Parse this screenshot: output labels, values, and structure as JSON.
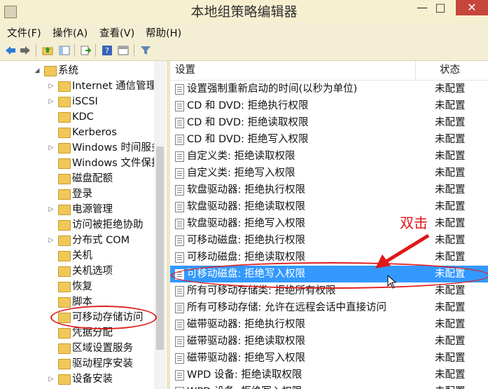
{
  "window": {
    "title": "本地组策略编辑器",
    "min": "—",
    "max": "□",
    "close": "✕"
  },
  "menu": [
    "文件(F)",
    "操作(A)",
    "查看(V)",
    "帮助(H)"
  ],
  "toolbar": {
    "icons": [
      "back-arrow-icon",
      "forward-arrow-icon",
      "up-folder-icon",
      "show-hide-tree-icon",
      "export-list-icon",
      "help-icon",
      "extended-view-icon",
      "filter-icon"
    ]
  },
  "tree": {
    "items": [
      {
        "label": "系统",
        "arrow": "◢",
        "indent": 0
      },
      {
        "label": "Internet 通信管理",
        "arrow": "▷",
        "indent": 1
      },
      {
        "label": "iSCSI",
        "arrow": "▷",
        "indent": 1
      },
      {
        "label": "KDC",
        "arrow": "",
        "indent": 1
      },
      {
        "label": "Kerberos",
        "arrow": "",
        "indent": 1
      },
      {
        "label": "Windows 时间服务",
        "arrow": "▷",
        "indent": 1
      },
      {
        "label": "Windows 文件保护",
        "arrow": "",
        "indent": 1
      },
      {
        "label": "磁盘配额",
        "arrow": "",
        "indent": 1
      },
      {
        "label": "登录",
        "arrow": "",
        "indent": 1
      },
      {
        "label": "电源管理",
        "arrow": "▷",
        "indent": 1
      },
      {
        "label": "访问被拒绝协助",
        "arrow": "",
        "indent": 1
      },
      {
        "label": "分布式 COM",
        "arrow": "▷",
        "indent": 1
      },
      {
        "label": "关机",
        "arrow": "",
        "indent": 1
      },
      {
        "label": "关机选项",
        "arrow": "",
        "indent": 1
      },
      {
        "label": "恢复",
        "arrow": "",
        "indent": 1
      },
      {
        "label": "脚本",
        "arrow": "",
        "indent": 1
      },
      {
        "label": "可移动存储访问",
        "arrow": "",
        "indent": 1
      },
      {
        "label": "凭据分配",
        "arrow": "",
        "indent": 1
      },
      {
        "label": "区域设置服务",
        "arrow": "",
        "indent": 1
      },
      {
        "label": "驱动程序安装",
        "arrow": "",
        "indent": 1
      },
      {
        "label": "设备安装",
        "arrow": "▷",
        "indent": 1
      }
    ]
  },
  "list": {
    "columns": {
      "setting": "设置",
      "state": "状态"
    },
    "rows": [
      {
        "name": "设置强制重新启动的时间(以秒为单位)",
        "state": "未配置"
      },
      {
        "name": "CD 和 DVD: 拒绝执行权限",
        "state": "未配置"
      },
      {
        "name": "CD 和 DVD: 拒绝读取权限",
        "state": "未配置"
      },
      {
        "name": "CD 和 DVD: 拒绝写入权限",
        "state": "未配置"
      },
      {
        "name": "自定义类: 拒绝读取权限",
        "state": "未配置"
      },
      {
        "name": "自定义类: 拒绝写入权限",
        "state": "未配置"
      },
      {
        "name": "软盘驱动器: 拒绝执行权限",
        "state": "未配置"
      },
      {
        "name": "软盘驱动器: 拒绝读取权限",
        "state": "未配置"
      },
      {
        "name": "软盘驱动器: 拒绝写入权限",
        "state": "未配置"
      },
      {
        "name": "可移动磁盘: 拒绝执行权限",
        "state": "未配置"
      },
      {
        "name": "可移动磁盘: 拒绝读取权限",
        "state": "未配置"
      },
      {
        "name": "可移动磁盘: 拒绝写入权限",
        "state": "未配置"
      },
      {
        "name": "所有可移动存储类: 拒绝所有权限",
        "state": "未配置"
      },
      {
        "name": "所有可移动存储: 允许在远程会话中直接访问",
        "state": "未配置"
      },
      {
        "name": "磁带驱动器: 拒绝执行权限",
        "state": "未配置"
      },
      {
        "name": "磁带驱动器: 拒绝读取权限",
        "state": "未配置"
      },
      {
        "name": "磁带驱动器: 拒绝写入权限",
        "state": "未配置"
      },
      {
        "name": "WPD 设备: 拒绝读取权限",
        "state": "未配置"
      },
      {
        "name": "WPD 设备: 拒绝写入权限",
        "state": "未配置"
      }
    ]
  },
  "annotation": {
    "text": "双击",
    "color": "#e01818"
  },
  "colors": {
    "selection": "#3399ff",
    "titlebar": "#f7f0d0",
    "close": "#c7463c"
  }
}
